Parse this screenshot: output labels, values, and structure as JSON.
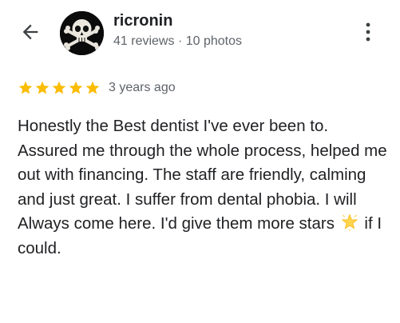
{
  "header": {
    "author_name": "ricronin",
    "reviews_count": "41 reviews",
    "separator": "·",
    "photos_count": "10 photos",
    "back_icon": "arrow-back-icon",
    "more_icon": "more-vert-icon"
  },
  "rating": {
    "stars": 5,
    "max_stars": 5,
    "star_color": "#fbbc04",
    "time_ago": "3 years ago"
  },
  "review": {
    "text_before_emoji": "Honestly the Best dentist I've ever been to. Assured me through the whole process, helped me out with financing. The staff are friendly, calming and just great. I suffer from dental phobia. I will Always come here. I'd give them more stars",
    "emoji": "glowing-star",
    "text_after_emoji": "if I could."
  }
}
